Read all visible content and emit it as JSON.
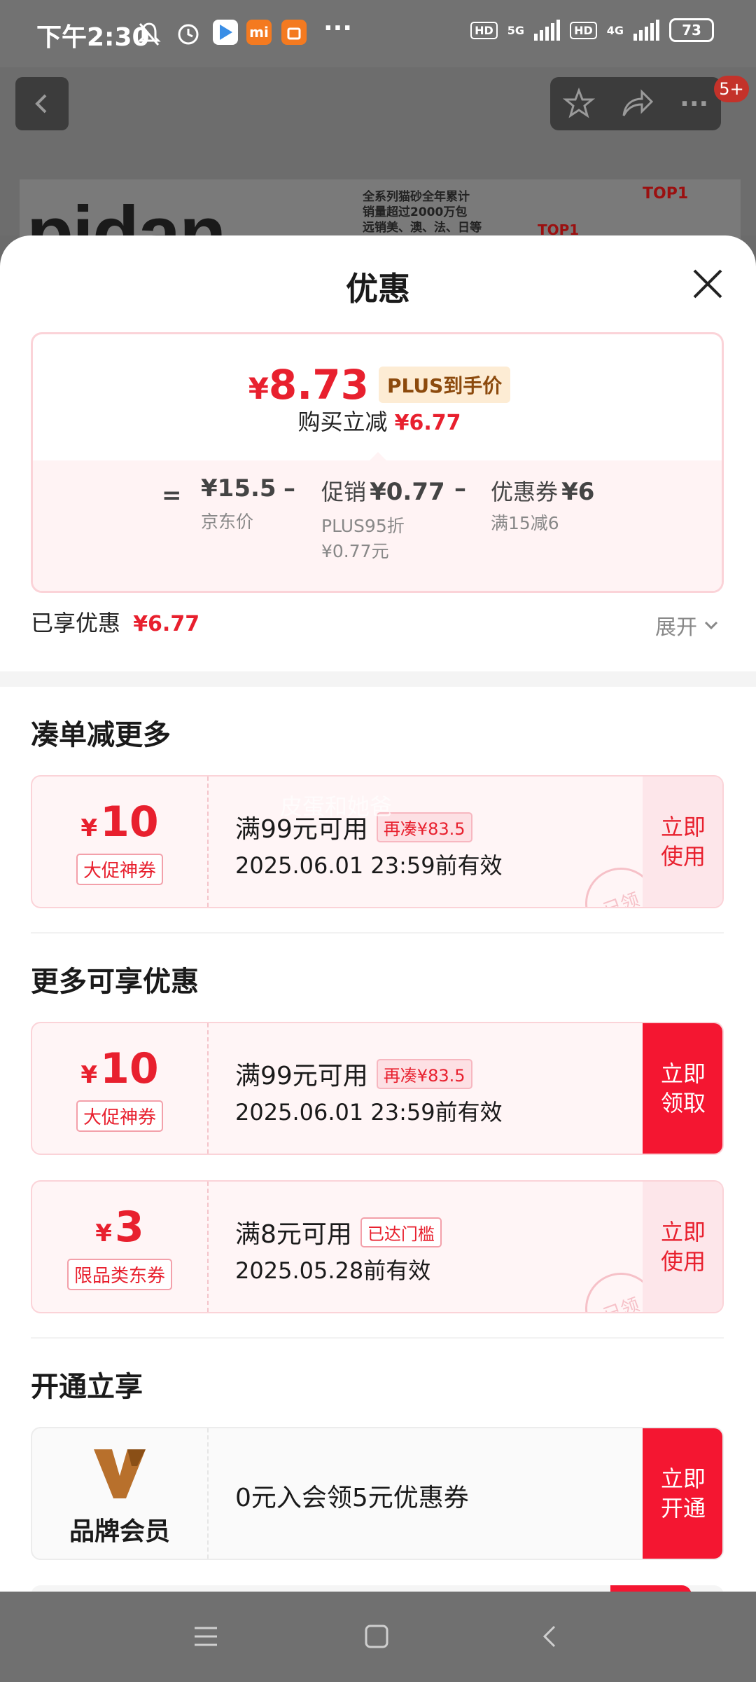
{
  "status_bar": {
    "time": "下午2:30",
    "hd1": "HD",
    "net1": "5G",
    "hd2": "HD",
    "net2": "4G",
    "battery": "73",
    "more": "···"
  },
  "header": {
    "notification_badge": "5+"
  },
  "banner": {
    "logo": "pidan",
    "text_lines": [
      "全系列猫砂全年累计",
      "销量超过2000万包",
      "远销美、澳、法、日等"
    ],
    "top_label_1": "TOP1",
    "top_label_2": "TOP1"
  },
  "sheet": {
    "title": "优惠"
  },
  "summary": {
    "currency": "¥",
    "final_price": "8.73",
    "plus_tag": "PLUS到手价",
    "reduce_label": "购买立减",
    "reduce_value": "¥6.77",
    "eq": "=",
    "minus": "–",
    "jd_price": "¥15.5",
    "jd_price_label": "京东价",
    "promo_label": "促销",
    "promo_value": "¥0.77",
    "promo_sub1": "PLUS95折",
    "promo_sub2": "¥0.77元",
    "coupon_label": "优惠券",
    "coupon_value": "¥6",
    "coupon_sub": "满15减6"
  },
  "enjoyed": {
    "label": "已享优惠",
    "value": "¥6.77",
    "expand": "展开"
  },
  "section_more_order": {
    "title": "凑单减更多",
    "watermark": "皮蛋和她爸",
    "coupon": {
      "currency": "¥",
      "amount": "10",
      "tag": "大促神券",
      "condition": "满99元可用",
      "pill": "再凑¥83.5",
      "date": "2025.06.01 23:59前有效",
      "button": "立即\n使用",
      "stamp": "已领"
    }
  },
  "section_more": {
    "title": "更多可享优惠",
    "coupons": [
      {
        "currency": "¥",
        "amount": "10",
        "tag": "大促神券",
        "condition": "满99元可用",
        "pill": "再凑¥83.5",
        "date": "2025.06.01 23:59前有效",
        "button": "立即\n领取"
      },
      {
        "currency": "¥",
        "amount": "3",
        "tag": "限品类东券",
        "condition": "满8元可用",
        "pill": "已达门槛",
        "date": "2025.05.28前有效",
        "button": "立即\n使用",
        "stamp": "已领"
      }
    ]
  },
  "section_open": {
    "title": "开通立享",
    "member": {
      "label": "品牌会员",
      "text": "0元入会领5元优惠券",
      "button": "立即\n开通"
    }
  },
  "colors": {
    "accent_red": "#e8202e",
    "button_red": "#f41631",
    "plus_gold": "#8c4a0d"
  }
}
